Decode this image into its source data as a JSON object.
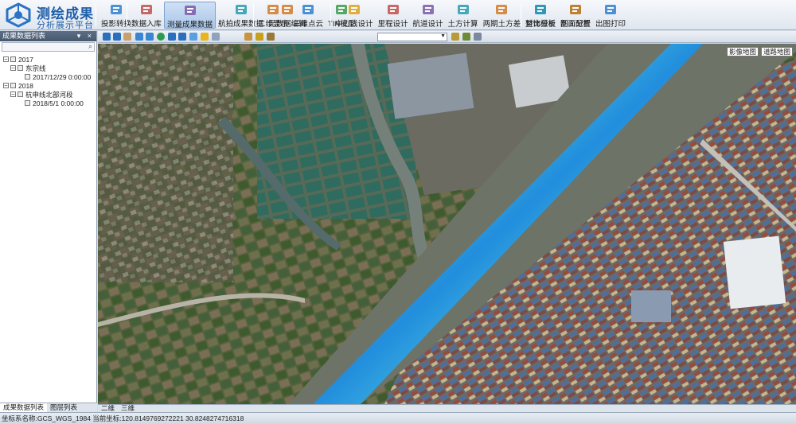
{
  "app": {
    "title": "测绘成果",
    "subtitle": "分析展示平台"
  },
  "ribbon": {
    "groups": [
      [
        {
          "label": "投影转换",
          "icon": "coordinate-transform-icon"
        }
      ],
      [
        {
          "label": "数据入库",
          "icon": "database-import-icon"
        },
        {
          "label": "测量成果数据",
          "icon": "survey-data-icon",
          "active": true
        },
        {
          "label": "航拍成果数据",
          "icon": "aerial-photo-icon"
        },
        {
          "label": "元数据编辑",
          "icon": "metadata-edit-icon"
        }
      ],
      [
        {
          "label": "二维显示",
          "icon": "2d-view-icon"
        },
        {
          "label": "三维点云",
          "icon": "point-cloud-icon"
        },
        {
          "label": "TIN模型",
          "icon": "tin-model-icon"
        }
      ],
      [
        {
          "label": "中心线设计",
          "icon": "centerline-icon"
        },
        {
          "label": "里程设计",
          "icon": "mileage-icon"
        },
        {
          "label": "航道设计",
          "icon": "channel-design-icon"
        },
        {
          "label": "土方计算",
          "icon": "earthwork-icon"
        },
        {
          "label": "两期土方差",
          "icon": "earthwork-diff-icon"
        },
        {
          "label": "对比分析",
          "icon": "compare-chart-icon"
        },
        {
          "label": "剖面分析",
          "icon": "profile-icon"
        }
      ],
      [
        {
          "label": "整饰模板",
          "icon": "template-icon"
        },
        {
          "label": "图面配置",
          "icon": "map-config-icon"
        },
        {
          "label": "出图打印",
          "icon": "print-icon"
        }
      ]
    ]
  },
  "panel": {
    "title": "成果数据列表",
    "controls": "▾ ×",
    "tree": {
      "y2017": {
        "label": "2017"
      },
      "east": {
        "label": "东宗线"
      },
      "east_date": {
        "label": "2017/12/29 0:00:00"
      },
      "y2018": {
        "label": "2018"
      },
      "shenlang": {
        "label": "杭申线北部河段"
      },
      "shenlang_date": {
        "label": "2018/5/1 0:00:00"
      }
    },
    "tabs": {
      "data": "成果数据列表",
      "layers": "图层列表"
    }
  },
  "map": {
    "basemap_image": "影像地图",
    "basemap_road": "道路地图",
    "view_2d": "二维",
    "view_3d": "三维"
  },
  "status": {
    "text": "坐标系名称:GCS_WGS_1984 当前坐标:120.8149769272221 30.8248274716318"
  },
  "colors": {
    "accent": "#1f5ea8",
    "panel_header": "#4e6078",
    "depth_shallow": "#f47a1f",
    "depth_mid": "#f2e619",
    "depth_deep": "#1e8fe3"
  }
}
